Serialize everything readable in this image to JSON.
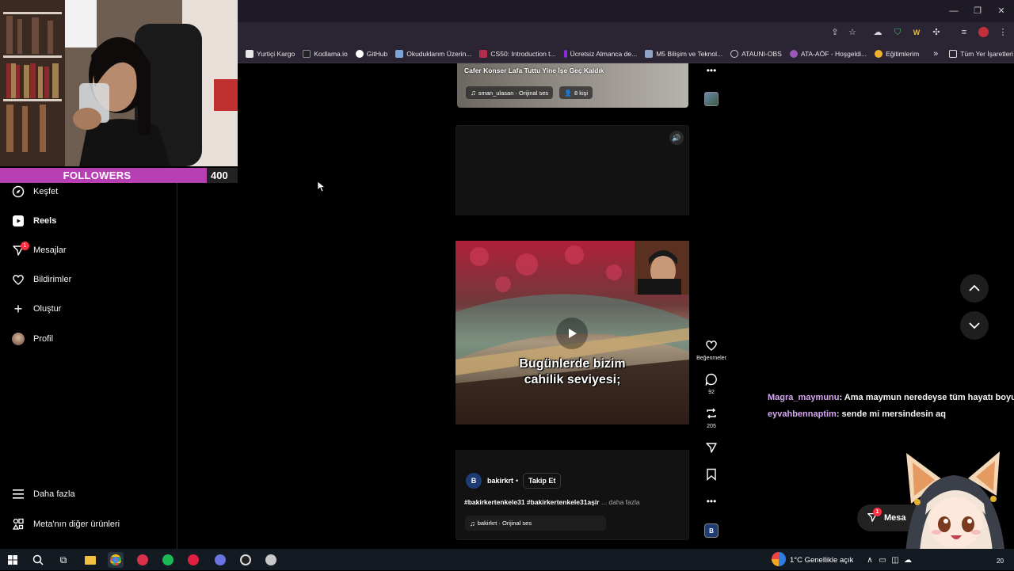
{
  "overlay": {
    "followers_label": "FOLLOWERS",
    "followers_count": "400",
    "followers_progress": 0.87
  },
  "browser": {
    "bookmarks": [
      {
        "label": "Yurtiçi Kargo",
        "color": "#e8e8e8"
      },
      {
        "label": "Kodlama.io",
        "color": "#222222"
      },
      {
        "label": "GitHub",
        "color": "#ffffff"
      },
      {
        "label": "Okuduklarım Üzerin...",
        "color": "#7aa7d8"
      },
      {
        "label": "CS50: Introduction t...",
        "color": "#b0304a"
      },
      {
        "label": "Ücretsiz Almanca de...",
        "color": "#8a2be2"
      },
      {
        "label": "M5 Bilişim ve Teknol...",
        "color": "#8fa3c8"
      },
      {
        "label": "ATAUNI-OBS",
        "color": "#cccccc"
      },
      {
        "label": "ATA-AÖF - Hoşgeldi...",
        "color": "#9b59b6"
      },
      {
        "label": "Eğitimlerim",
        "color": "#f0b030"
      }
    ],
    "more_bookmarks": "»",
    "all_bookmarks": "Tüm Yer İşaretleri"
  },
  "sidebar": {
    "items": [
      {
        "label": "Keşfet",
        "icon": "compass-icon"
      },
      {
        "label": "Reels",
        "icon": "reels-icon"
      },
      {
        "label": "Mesajlar",
        "icon": "messenger-icon",
        "badge": "1"
      },
      {
        "label": "Bildirimler",
        "icon": "heart-icon"
      },
      {
        "label": "Oluştur",
        "icon": "plus-icon"
      },
      {
        "label": "Profil",
        "icon": "avatar-icon"
      }
    ],
    "bottom": [
      {
        "label": "Daha fazla",
        "icon": "menu-icon"
      },
      {
        "label": "Meta'nın diğer ürünleri",
        "icon": "grid-icon"
      }
    ]
  },
  "prev_post": {
    "caption": "Cafer Konser Lafa Tuttu Yine İşe Geç Kaldık",
    "audio": "sman_ulasan · Orijinal ses",
    "people": "8 kişi"
  },
  "post": {
    "subtitle_line1": "Bugünlerde bizim",
    "subtitle_line2": "cahilik seviyesi;",
    "username": "bakirkrt",
    "dot": "•",
    "follow_label": "Takip Et",
    "hashtags": "#bakirkertenkele31 #bakirkertenkele31aşir",
    "more_label": "... daha fazla",
    "audio": "bakirkrt · Orijinal ses"
  },
  "actions": {
    "like_label": "Beğenmeler",
    "comments": "92",
    "reposts": "205"
  },
  "chat": [
    {
      "user": "Magra_maymunu",
      "text": ": Ama maymun neredeyse tüm hayatı boyunca"
    },
    {
      "user": "eyvahbennaptim",
      "text": ": sende mi mersindesin aq"
    }
  ],
  "messages_chip": {
    "label": "Mesa",
    "badge": "1"
  },
  "taskbar": {
    "weather": "1°C  Genellikle açık",
    "time": "20"
  }
}
